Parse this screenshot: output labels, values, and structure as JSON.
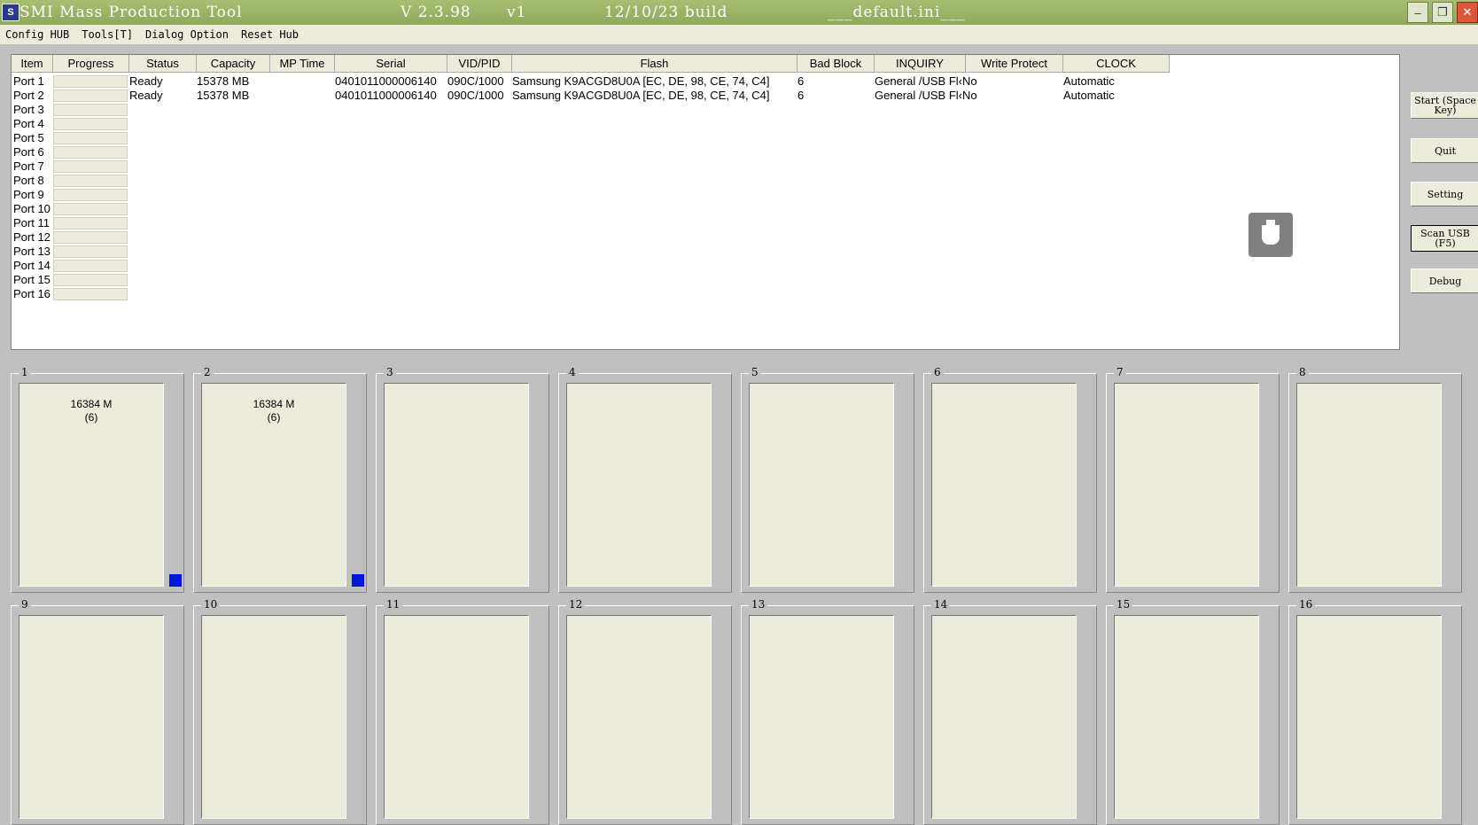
{
  "titlebar": {
    "app_name": "SMI Mass Production Tool",
    "version": "V 2.3.98",
    "variant": "v1",
    "build": "12/10/23 build",
    "ini_file": "___default.ini___"
  },
  "menu": [
    "Config HUB",
    "Tools[T]",
    "Dialog Option",
    "Reset Hub"
  ],
  "table": {
    "columns": [
      "Item",
      "Progress",
      "Status",
      "Capacity",
      "MP Time",
      "Serial",
      "VID/PID",
      "Flash",
      "Bad Block",
      "INQUIRY",
      "Write Protect",
      "CLOCK"
    ],
    "ports": [
      "Port 1",
      "Port 2",
      "Port 3",
      "Port 4",
      "Port 5",
      "Port 6",
      "Port 7",
      "Port 8",
      "Port 9",
      "Port 10",
      "Port 11",
      "Port 12",
      "Port 13",
      "Port 14",
      "Port 15",
      "Port 16"
    ],
    "rows": [
      {
        "status": "Ready",
        "capacity": "15378 MB",
        "mp_time": "",
        "serial": "0401011000006140",
        "vidpid": "090C/1000",
        "flash": "Samsung K9ACGD8U0A [EC, DE, 98, CE, 74, C4]",
        "bad_block": "6",
        "inquiry": "General /USB Fl‹No",
        "write_protect": "",
        "clock": "Automatic"
      },
      {
        "status": "Ready",
        "capacity": "15378 MB",
        "mp_time": "",
        "serial": "0401011000006140",
        "vidpid": "090C/1000",
        "flash": "Samsung K9ACGD8U0A [EC, DE, 98, CE, 74, C4]",
        "bad_block": "6",
        "inquiry": "General /USB Fl‹No",
        "write_protect": "",
        "clock": "Automatic"
      }
    ]
  },
  "buttons": {
    "start": "Start (Space Key)",
    "quit": "Quit",
    "setting": "Setting",
    "scan": "Scan USB (F5)",
    "debug": "Debug"
  },
  "slots": [
    {
      "num": "1",
      "cap": "16384 M",
      "count": "(6)",
      "led": "#0016d8"
    },
    {
      "num": "2",
      "cap": "16384 M",
      "count": "(6)",
      "led": "#0016d8"
    },
    {
      "num": "3"
    },
    {
      "num": "4"
    },
    {
      "num": "5"
    },
    {
      "num": "6"
    },
    {
      "num": "7"
    },
    {
      "num": "8"
    },
    {
      "num": "9"
    },
    {
      "num": "10"
    },
    {
      "num": "11"
    },
    {
      "num": "12"
    },
    {
      "num": "13"
    },
    {
      "num": "14"
    },
    {
      "num": "15"
    },
    {
      "num": "16"
    }
  ],
  "icons": {
    "usb": "usb-drive-icon"
  }
}
